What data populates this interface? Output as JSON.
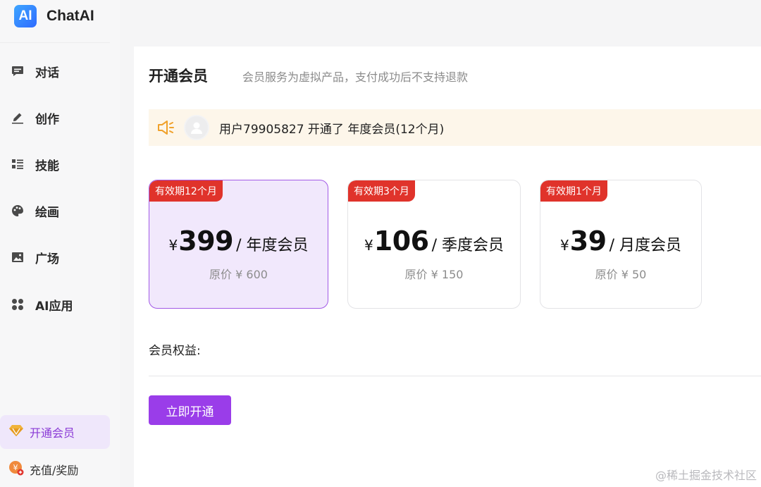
{
  "app": {
    "logo_text": "AI",
    "name": "ChatAI"
  },
  "sidebar": {
    "items": [
      {
        "label": "对话",
        "icon": "chat-icon"
      },
      {
        "label": "创作",
        "icon": "pen-icon"
      },
      {
        "label": "技能",
        "icon": "list-icon"
      },
      {
        "label": "绘画",
        "icon": "palette-icon"
      },
      {
        "label": "广场",
        "icon": "image-icon"
      },
      {
        "label": "AI应用",
        "icon": "apps-icon"
      }
    ],
    "member": {
      "label": "开通会员",
      "icon": "diamond-icon"
    },
    "recharge": {
      "label": "充值/奖励",
      "icon": "coin-icon"
    }
  },
  "main": {
    "title": "开通会员",
    "subtitle": "会员服务为虚拟产品，支付成功后不支持退款",
    "notice": "用户79905827 开通了 年度会员(12个月)",
    "plans": [
      {
        "tag": "有效期12个月",
        "currency": "¥",
        "price": "399",
        "unit": "/ 年度会员",
        "original": "原价 ¥ 600",
        "selected": true
      },
      {
        "tag": "有效期3个月",
        "currency": "¥",
        "price": "106",
        "unit": "/ 季度会员",
        "original": "原价 ¥ 150",
        "selected": false
      },
      {
        "tag": "有效期1个月",
        "currency": "¥",
        "price": "39",
        "unit": "/ 月度会员",
        "original": "原价 ¥ 50",
        "selected": false
      }
    ],
    "benefits_label": "会员权益:",
    "open_button": "立即开通"
  },
  "watermark": "@稀土掘金技术社区",
  "colors": {
    "accent": "#9a3de9",
    "tag_red": "#e0332b",
    "notice_bg": "#fdf6ea",
    "selected_bg": "#f1e8fc"
  }
}
